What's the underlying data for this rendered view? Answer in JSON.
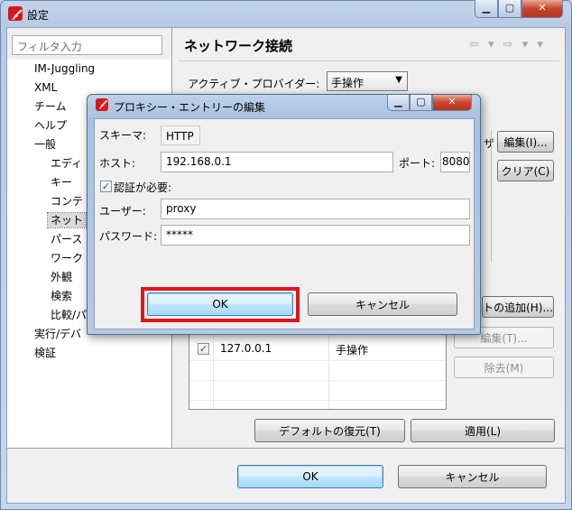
{
  "window": {
    "title": "設定",
    "controls": {
      "minimize": "▁",
      "maximize": "▢",
      "close": "✕"
    }
  },
  "sidebar": {
    "filter_placeholder": "フィルタ入力",
    "items": [
      {
        "label": "IM-Juggling",
        "level": 1
      },
      {
        "label": "XML",
        "level": 1
      },
      {
        "label": "チーム",
        "level": 1
      },
      {
        "label": "ヘルプ",
        "level": 1
      },
      {
        "label": "一般",
        "level": 1
      },
      {
        "label": "エディ",
        "level": 2
      },
      {
        "label": "キー",
        "level": 2
      },
      {
        "label": "コンテ",
        "level": 2
      },
      {
        "label": "ネット",
        "level": 2,
        "selected": true
      },
      {
        "label": "パース",
        "level": 2
      },
      {
        "label": "ワーク",
        "level": 2
      },
      {
        "label": "外観",
        "level": 2
      },
      {
        "label": "検索",
        "level": 2
      },
      {
        "label": "比較/パ",
        "level": 2
      },
      {
        "label": "実行/デバ",
        "level": 1
      },
      {
        "label": "検証",
        "level": 1
      }
    ]
  },
  "panel": {
    "title": "ネットワーク接続",
    "nav": "⇦ ▾ ⇨ ▾ ▾",
    "provider_label": "アクティブ・プロバイダー:",
    "provider_value": "手操作",
    "edit_button": "編集(I)...",
    "clear_button": "クリア(C)",
    "partial_label": "ザ",
    "add_host_button": "トの追加(H)...",
    "bypass_edit_button": "編集(T)...",
    "bypass_remove_button": "除去(M)",
    "bypass_rows": [
      {
        "checked": true,
        "host": "127.0.0.1",
        "provider": "手操作"
      }
    ],
    "restore_defaults_button": "デフォルトの復元(T)",
    "apply_button": "適用(L)"
  },
  "footer": {
    "ok_button": "OK",
    "cancel_button": "キャンセル"
  },
  "dialog": {
    "title": "プロキシー・エントリーの編集",
    "scheme_label": "スキーマ:",
    "scheme_value": "HTTP",
    "host_label": "ホスト:",
    "host_value": "192.168.0.1",
    "port_label": "ポート:",
    "port_value": "8080",
    "auth_checkbox_label": "認証が必要:",
    "auth_checked": true,
    "user_label": "ユーザー:",
    "user_value": "proxy",
    "password_label": "パスワード:",
    "password_value": "*****",
    "ok_button": "OK",
    "cancel_button": "キャンセル",
    "highlight_color": "#e0161c"
  }
}
